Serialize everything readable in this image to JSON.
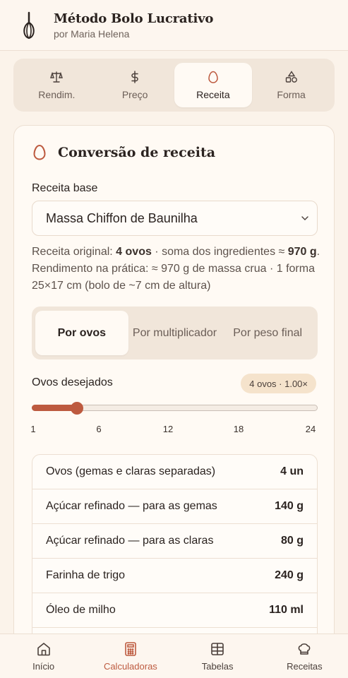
{
  "header": {
    "title": "Método Bolo Lucrativo",
    "subtitle": "por Maria Helena"
  },
  "tabs": [
    {
      "label": "Rendim.",
      "icon": "scale-icon",
      "active": false
    },
    {
      "label": "Preço",
      "icon": "dollar-icon",
      "active": false
    },
    {
      "label": "Receita",
      "icon": "egg-icon",
      "active": true
    },
    {
      "label": "Forma",
      "icon": "shapes-icon",
      "active": false
    }
  ],
  "card": {
    "title": "Conversão de receita",
    "base_label": "Receita base",
    "base_value": "Massa Chiffon de Baunilha",
    "info": {
      "t1": "Receita original: ",
      "b1": "4 ovos",
      "t2": " · soma dos ingredientes ≈ ",
      "b2": "970 g",
      "t3": ". Rendimento na prática: ≈ 970 g de massa crua · 1 forma 25×17 cm (bolo de ~7 cm de altura)"
    },
    "modes": [
      "Por ovos",
      "Por multiplicador",
      "Por peso final"
    ],
    "active_mode": "Por ovos",
    "ovos_label": "Ovos desejados",
    "ovos_badge": "4 ovos · 1.00×",
    "slider": {
      "min": 1,
      "max": 24,
      "value": 4
    },
    "ticks": [
      "1",
      "6",
      "12",
      "18",
      "24"
    ],
    "ingredients": [
      {
        "name": "Ovos (gemas e claras separadas)",
        "amount": "4 un"
      },
      {
        "name": "Açúcar refinado — para as gemas",
        "amount": "140 g"
      },
      {
        "name": "Açúcar refinado — para as claras",
        "amount": "80 g"
      },
      {
        "name": "Farinha de trigo",
        "amount": "240 g"
      },
      {
        "name": "Óleo de milho",
        "amount": "110 ml"
      },
      {
        "name": "",
        "amount": ""
      }
    ]
  },
  "nav": [
    {
      "label": "Início",
      "icon": "home-icon",
      "active": false
    },
    {
      "label": "Calculadoras",
      "icon": "calculator-icon",
      "active": true
    },
    {
      "label": "Tabelas",
      "icon": "table-icon",
      "active": false
    },
    {
      "label": "Receitas",
      "icon": "chef-hat-icon",
      "active": false
    }
  ],
  "colors": {
    "accent": "#bd5a3f",
    "background": "#fbf3ea",
    "card": "#fffaf4",
    "badge": "#f5e3cc"
  }
}
